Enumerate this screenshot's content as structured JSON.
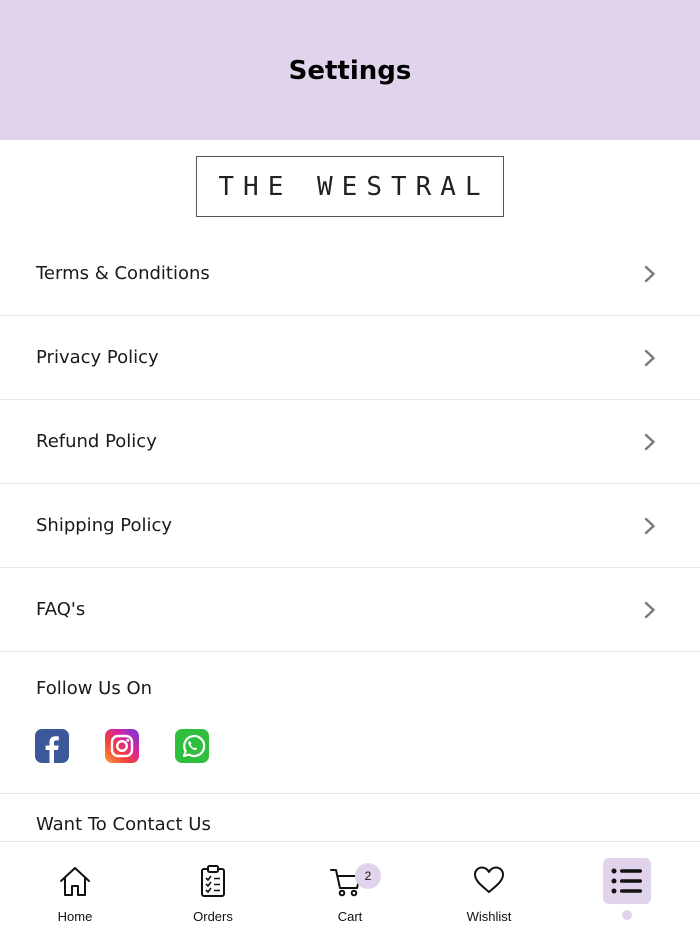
{
  "header": {
    "title": "Settings"
  },
  "logo": {
    "text": "THE WESTRAL"
  },
  "menu": {
    "items": [
      {
        "label": "Terms & Conditions"
      },
      {
        "label": "Privacy Policy"
      },
      {
        "label": "Refund Policy"
      },
      {
        "label": "Shipping Policy"
      },
      {
        "label": "FAQ's"
      }
    ]
  },
  "follow": {
    "title": "Follow Us On",
    "icons": [
      "facebook-icon",
      "instagram-icon",
      "whatsapp-icon"
    ]
  },
  "contact": {
    "title": "Want To Contact Us"
  },
  "tabbar": {
    "tabs": [
      {
        "label": "Home",
        "icon": "home-icon"
      },
      {
        "label": "Orders",
        "icon": "clipboard-icon"
      },
      {
        "label": "Cart",
        "icon": "cart-icon",
        "badge": "2"
      },
      {
        "label": "Wishlist",
        "icon": "heart-icon"
      },
      {
        "label": "",
        "icon": "menu-list-icon",
        "active": true
      }
    ]
  },
  "colors": {
    "accent": "#e2d3ec",
    "divider": "#e6e6e6"
  }
}
